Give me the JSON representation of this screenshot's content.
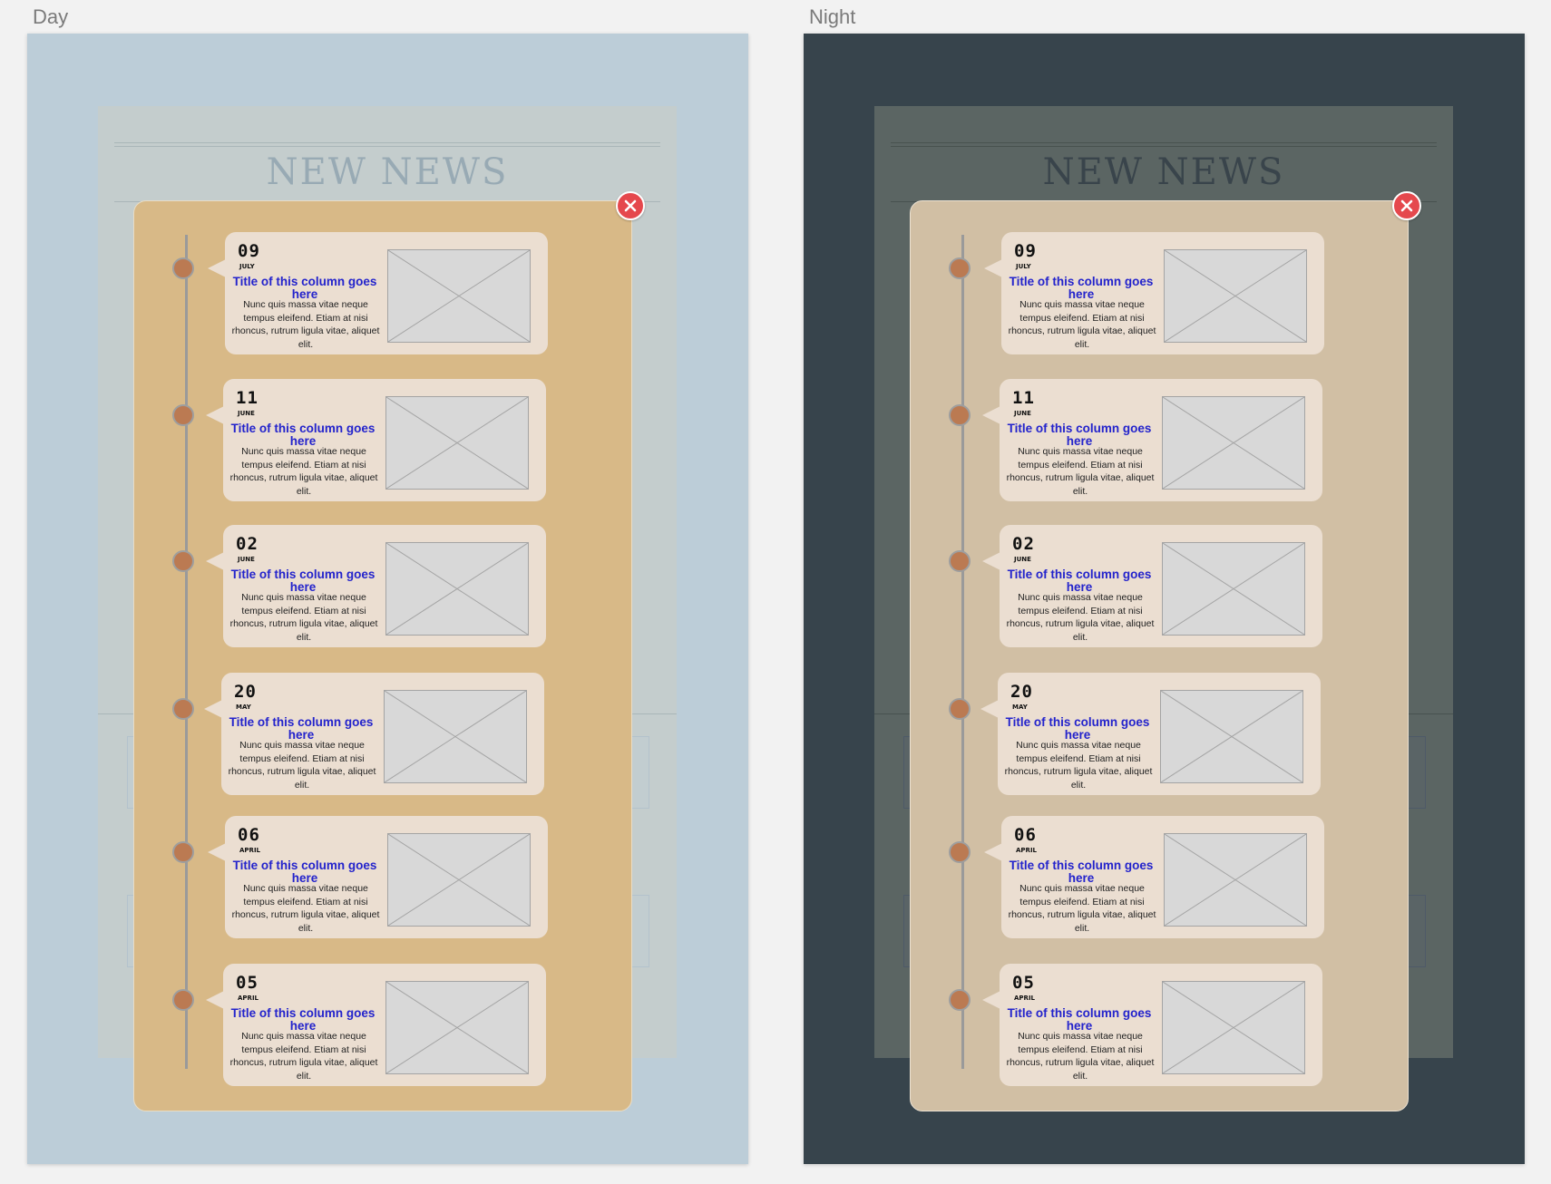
{
  "artboards": [
    {
      "label": "Day"
    },
    {
      "label": "Night"
    }
  ],
  "page": {
    "title": "NEW NEWS"
  },
  "colors": {
    "day_background": "#bccdd8",
    "night_background": "#37444c",
    "day_modal": "#d8b987",
    "night_modal": "#d1bfa4",
    "card": "#ebded1",
    "timeline_dot": "#bb7a52",
    "title_link": "#2323cc",
    "close": "#e5484d"
  },
  "icons": {
    "close": "close-x-icon",
    "thumbnail": "image-placeholder-icon"
  },
  "timeline": [
    {
      "day": "09",
      "month": "JULY",
      "title": "Title of this column goes here",
      "text": "Nunc quis massa vitae neque tempus eleifend. Etiam at nisi rhoncus, rutrum ligula vitae, aliquet elit."
    },
    {
      "day": "11",
      "month": "JUNE",
      "title": "Title of this column goes here",
      "text": "Nunc quis massa vitae neque tempus eleifend. Etiam at nisi rhoncus, rutrum ligula vitae, aliquet elit."
    },
    {
      "day": "02",
      "month": "JUNE",
      "title": "Title of this column goes here",
      "text": "Nunc quis massa vitae neque tempus eleifend. Etiam at nisi rhoncus, rutrum ligula vitae, aliquet elit."
    },
    {
      "day": "20",
      "month": "MAY",
      "title": "Title of this column goes here",
      "text": "Nunc quis massa vitae neque tempus eleifend. Etiam at nisi rhoncus, rutrum ligula vitae, aliquet elit."
    },
    {
      "day": "06",
      "month": "APRIL",
      "title": "Title of this column goes here",
      "text": "Nunc quis massa vitae neque tempus eleifend. Etiam at nisi rhoncus, rutrum ligula vitae, aliquet elit."
    },
    {
      "day": "05",
      "month": "APRIL",
      "title": "Title of this column goes here",
      "text": "Nunc quis massa vitae neque tempus eleifend. Etiam at nisi rhoncus, rutrum ligula vitae, aliquet elit."
    }
  ]
}
